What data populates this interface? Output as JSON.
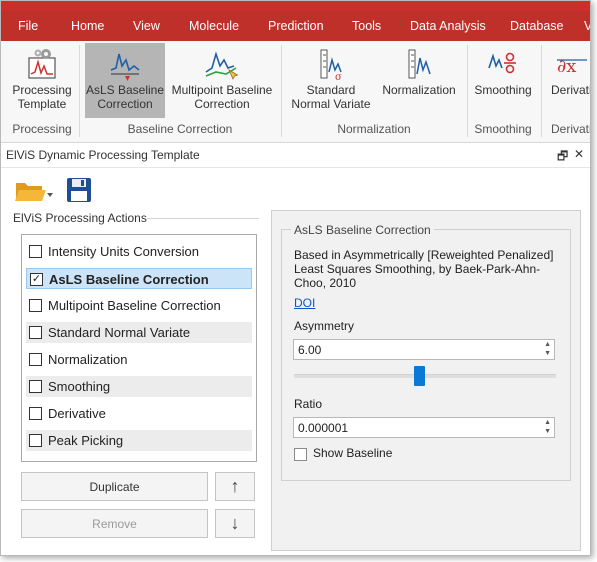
{
  "menu": {
    "file": "File",
    "home": "Home",
    "view": "View",
    "molecule": "Molecule",
    "prediction": "Prediction",
    "tools": "Tools",
    "data_analysis": "Data Analysis",
    "database": "Database",
    "overflow": "V"
  },
  "ribbon": {
    "processing_template": "Processing\nTemplate",
    "asls_baseline": "AsLS Baseline\nCorrection",
    "multipoint_baseline": "Multipoint Baseline\nCorrection",
    "standard_normal_variate": "Standard\nNormal Variate",
    "normalization": "Normalization",
    "smoothing": "Smoothing",
    "derivative": "Derivati",
    "groups": {
      "processing": "Processing",
      "baseline_correction": "Baseline Correction",
      "normalization": "Normalization",
      "smoothing": "Smoothing",
      "derivative": "Derivati"
    }
  },
  "panel": {
    "title": "ElViS Dynamic Processing Template",
    "pin_glyph": "🗗",
    "close_glyph": "✕"
  },
  "toolbar": {
    "open_folder_icon": "folder-open-icon",
    "save_icon": "save-icon"
  },
  "actions": {
    "title": "ElViS Processing Actions",
    "items": [
      {
        "label": "Intensity Units Conversion",
        "checked": false
      },
      {
        "label": "AsLS Baseline Correction",
        "checked": true
      },
      {
        "label": "Multipoint Baseline Correction",
        "checked": false
      },
      {
        "label": "Standard Normal Variate",
        "checked": false
      },
      {
        "label": "Normalization",
        "checked": false
      },
      {
        "label": "Smoothing",
        "checked": false
      },
      {
        "label": "Derivative",
        "checked": false
      },
      {
        "label": "Peak Picking",
        "checked": false
      }
    ],
    "check_glyph": "✓",
    "duplicate": "Duplicate",
    "remove": "Remove",
    "up": "↑",
    "down": "↓"
  },
  "settings": {
    "group_title": "AsLS Baseline Correction",
    "description": "Based in Asymmetrically [Reweighted Penalized] Least Squares Smoothing, by Baek-Park-Ahn-Choo, 2010",
    "doi": "DOI",
    "asymmetry_label": "Asymmetry",
    "asymmetry_value": "6.00",
    "asymmetry_slider_fraction": 0.48,
    "ratio_label": "Ratio",
    "ratio_value": "0.000001",
    "show_baseline_label": "Show Baseline",
    "show_baseline_checked": false
  },
  "colors": {
    "menu_bar": "#c0302a",
    "selected_ribbon": "#b5b5b5",
    "selected_row": "#cce4f7",
    "slider_thumb": "#0a7ad4",
    "link": "#0b57c9"
  }
}
